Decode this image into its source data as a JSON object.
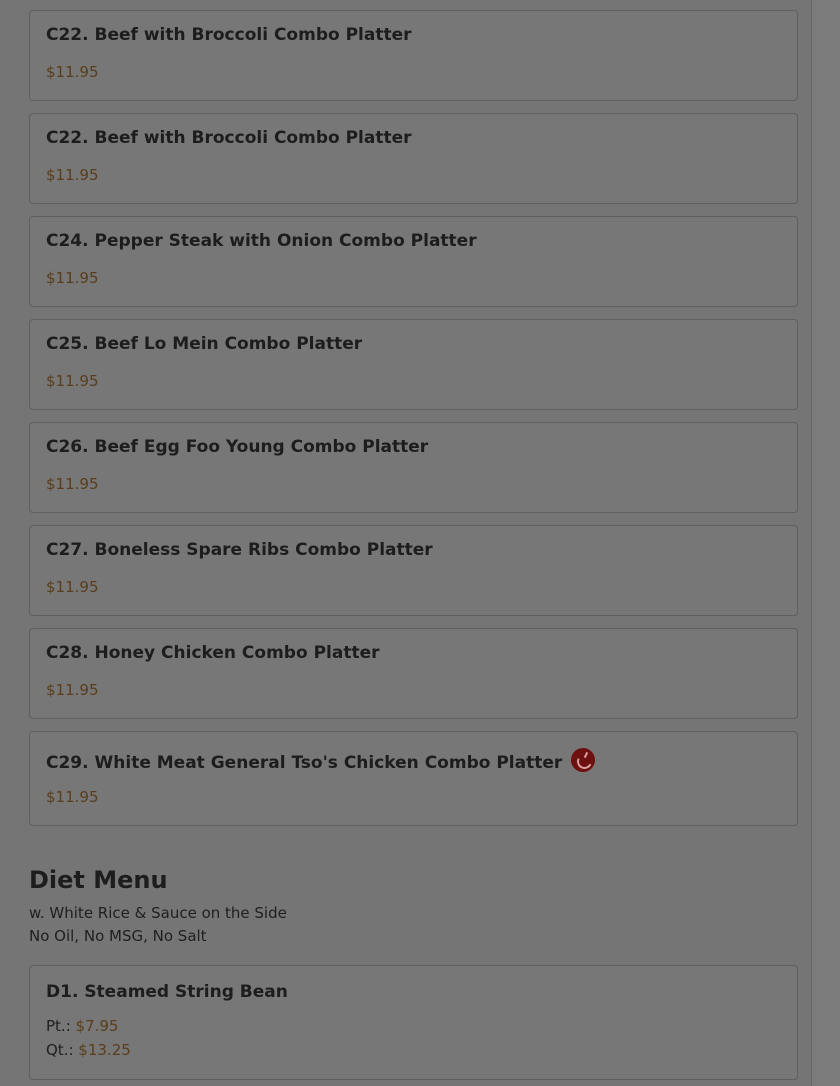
{
  "menu_items": [
    {
      "title": "C22. Beef with Broccoli Combo Platter",
      "price": "$11.95"
    },
    {
      "title": "C22. Beef with Broccoli Combo Platter",
      "price": "$11.95"
    },
    {
      "title": "C24. Pepper Steak with Onion Combo Platter",
      "price": "$11.95"
    },
    {
      "title": "C25. Beef Lo Mein Combo Platter",
      "price": "$11.95"
    },
    {
      "title": "C26. Beef Egg Foo Young Combo Platter",
      "price": "$11.95"
    },
    {
      "title": "C27. Boneless Spare Ribs Combo Platter",
      "price": "$11.95"
    },
    {
      "title": "C28. Honey Chicken Combo Platter",
      "price": "$11.95"
    },
    {
      "title": "C29. White Meat General Tso's Chicken Combo Platter",
      "price": "$11.95",
      "icon": "spicy-pepper-icon"
    }
  ],
  "diet_section": {
    "title": "Diet Menu",
    "notes": [
      "w. White Rice & Sauce on the Side",
      "No Oil, No MSG, No Salt"
    ],
    "items": [
      {
        "title": "D1. Steamed String Bean",
        "sizes": [
          {
            "label": "Pt.:",
            "price": "$7.95"
          },
          {
            "label": "Qt.:",
            "price": "$13.25"
          }
        ]
      }
    ]
  },
  "colors": {
    "overlay_background": "#757575",
    "card_background": "#777777",
    "text": "#1d1d1d",
    "price": "#5a3d1a",
    "spicy_icon": "#6d1010"
  }
}
